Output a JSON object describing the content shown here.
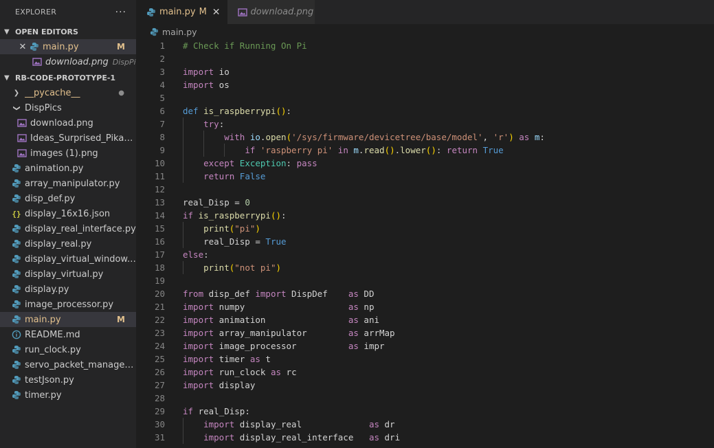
{
  "sidebar": {
    "title": "EXPLORER",
    "more": "···",
    "open_editors": {
      "title": "OPEN EDITORS",
      "items": [
        {
          "name": "main.py",
          "badge": "M"
        },
        {
          "name": "download.png",
          "desc": "DispPics"
        }
      ]
    },
    "project": {
      "title": "RB-CODE-PROTOTYPE-1",
      "pycache": "__pycache__",
      "disppics": "DispPics",
      "files_in_disppics": [
        "download.png",
        "Ideas_Surprised_Pikachu...",
        "images (1).png"
      ],
      "files": [
        "animation.py",
        "array_manipulator.py",
        "disp_def.py",
        "display_16x16.json",
        "display_real_interface.py",
        "display_real.py",
        "display_virtual_window.py",
        "display_virtual.py",
        "display.py",
        "image_processor.py",
        "main.py",
        "README.md",
        "run_clock.py",
        "servo_packet_manager.py",
        "testJson.py",
        "timer.py"
      ],
      "main_badge": "M"
    }
  },
  "tabs": [
    {
      "label": "main.py",
      "badge": "M",
      "close": "✕"
    },
    {
      "label": "download.png"
    }
  ],
  "breadcrumb": "main.py",
  "code_lines": [
    {
      "n": "1",
      "t": "# Check if Running On Pi"
    },
    {
      "n": "2",
      "t": ""
    },
    {
      "n": "3",
      "t": "import io"
    },
    {
      "n": "4",
      "t": "import os"
    },
    {
      "n": "5",
      "t": ""
    },
    {
      "n": "6",
      "t": "def is_raspberrypi():"
    },
    {
      "n": "7",
      "t": "    try:"
    },
    {
      "n": "8",
      "t": "        with io.open('/sys/firmware/devicetree/base/model', 'r') as m:"
    },
    {
      "n": "9",
      "t": "            if 'raspberry pi' in m.read().lower(): return True"
    },
    {
      "n": "10",
      "t": "    except Exception: pass"
    },
    {
      "n": "11",
      "t": "    return False"
    },
    {
      "n": "12",
      "t": ""
    },
    {
      "n": "13",
      "t": "real_Disp = 0"
    },
    {
      "n": "14",
      "t": "if is_raspberrypi():"
    },
    {
      "n": "15",
      "t": "    print(\"pi\")"
    },
    {
      "n": "16",
      "t": "    real_Disp = True"
    },
    {
      "n": "17",
      "t": "else:"
    },
    {
      "n": "18",
      "t": "    print(\"not pi\")"
    },
    {
      "n": "19",
      "t": ""
    },
    {
      "n": "20",
      "t": "from disp_def import DispDef    as DD"
    },
    {
      "n": "21",
      "t": "import numpy                    as np"
    },
    {
      "n": "22",
      "t": "import animation                as ani"
    },
    {
      "n": "23",
      "t": "import array_manipulator        as arrMap"
    },
    {
      "n": "24",
      "t": "import image_processor          as impr"
    },
    {
      "n": "25",
      "t": "import timer as t"
    },
    {
      "n": "26",
      "t": "import run_clock as rc"
    },
    {
      "n": "27",
      "t": "import display"
    },
    {
      "n": "28",
      "t": ""
    },
    {
      "n": "29",
      "t": "if real_Disp:"
    },
    {
      "n": "30",
      "t": "    import display_real             as dr"
    },
    {
      "n": "31",
      "t": "    import display_real_interface   as dri"
    }
  ]
}
